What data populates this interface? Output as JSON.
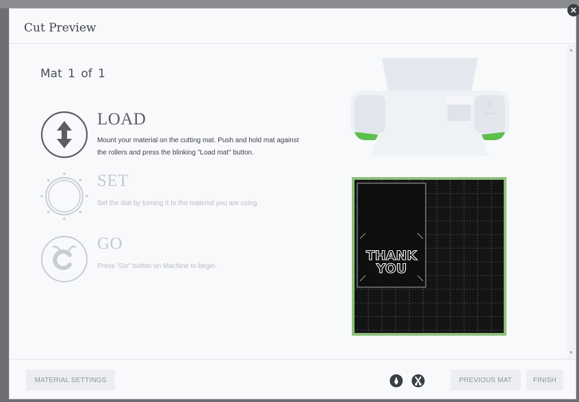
{
  "dialog": {
    "title": "Cut Preview",
    "close_icon": "close-icon"
  },
  "mat": {
    "counter": "Mat  1  of  1"
  },
  "steps": [
    {
      "title": "LOAD",
      "text": "Mount your material on the cutting mat. Push and hold mat against the rollers and press the blinking \"Load mat\" button.",
      "icon": "load-arrows-icon",
      "state": "active"
    },
    {
      "title": "SET",
      "text": "Set the dial by turning it to the material you are using.",
      "icon": "dial-icon",
      "state": "inactive"
    },
    {
      "title": "GO",
      "text": "Press \"Go\" button on Machine to begin.",
      "icon": "go-cricut-icon",
      "state": "inactive"
    }
  ],
  "preview": {
    "design_text_line1": "THANK",
    "design_text_line2": "YOU",
    "colors": {
      "mat_border": "#8cc07a",
      "mat_background": "#141414",
      "machine_accent": "#5cbf4b"
    }
  },
  "footer": {
    "material_settings_label": "MATERIAL SETTINGS",
    "previous_mat_label": "PREVIOUS MAT",
    "finish_label": "FINISH",
    "icons": [
      "pen-icon",
      "blade-icon"
    ]
  }
}
